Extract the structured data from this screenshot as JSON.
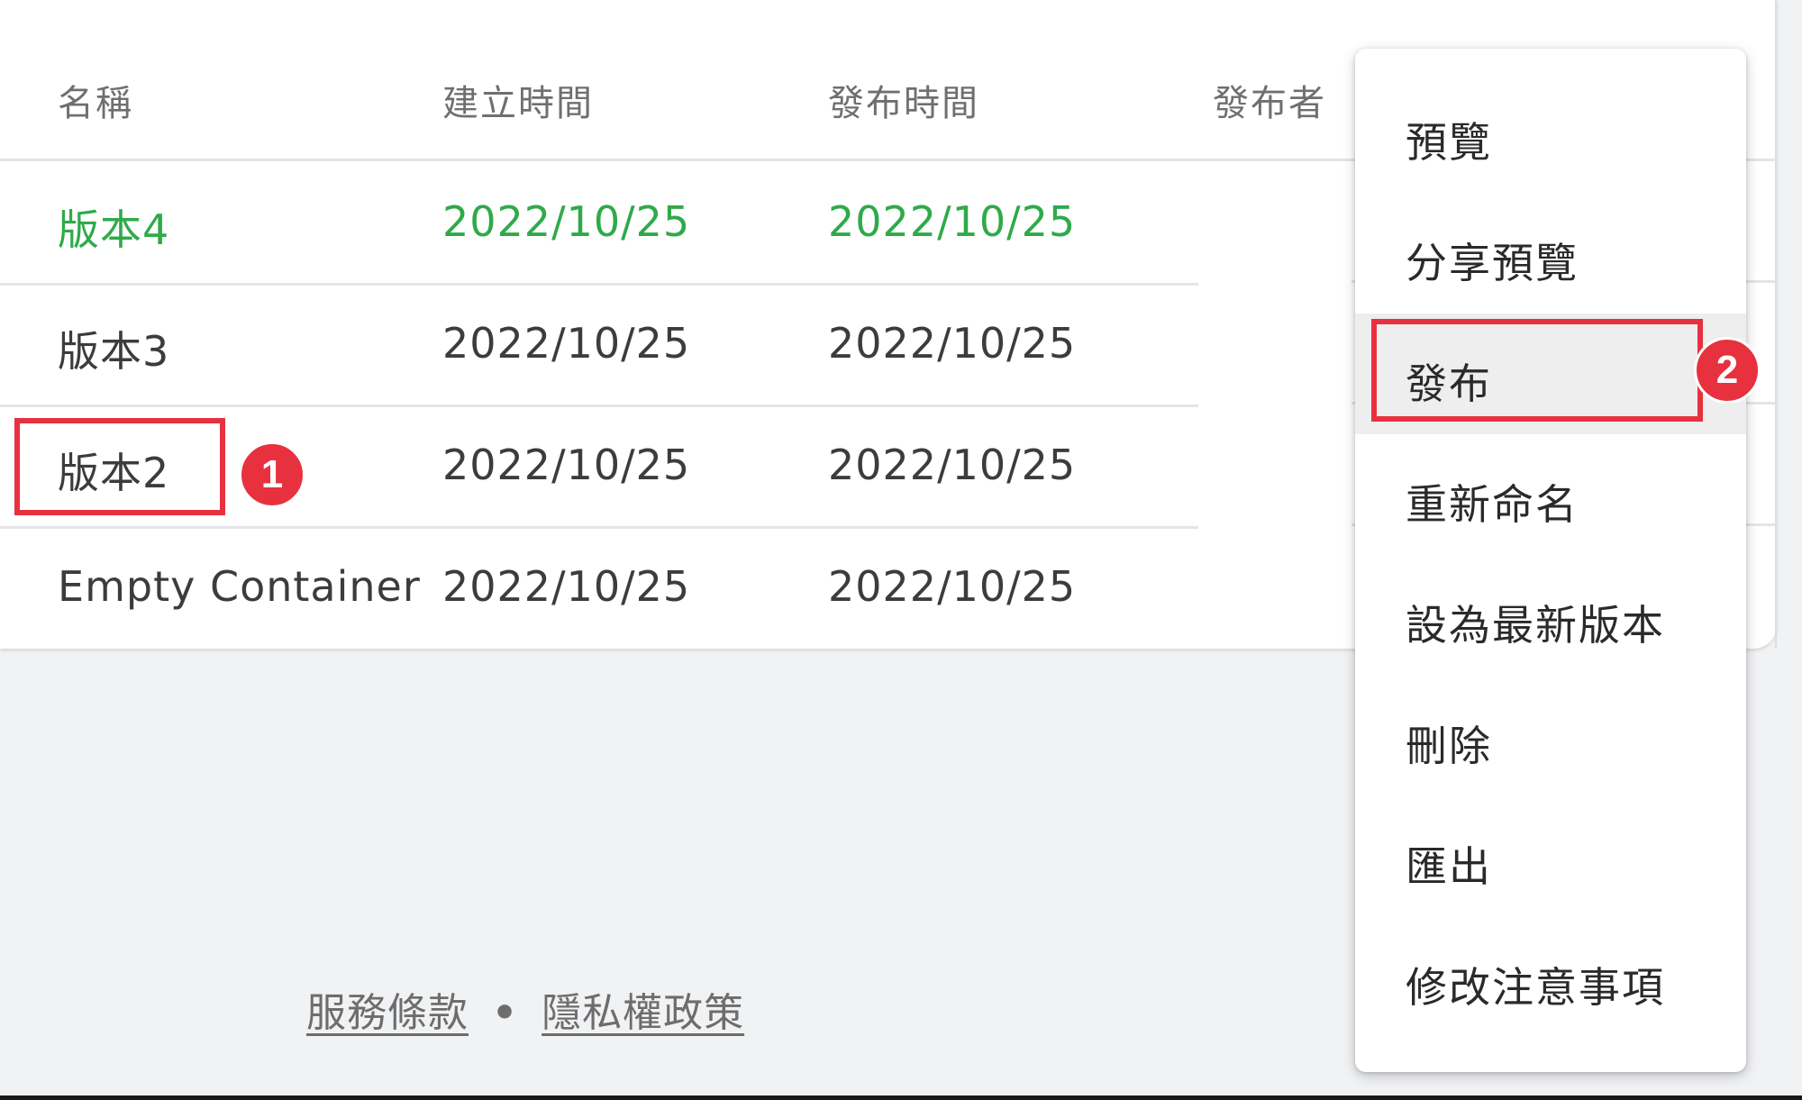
{
  "table": {
    "headers": [
      "名稱",
      "建立時間",
      "發布時間",
      "發布者"
    ],
    "rows": [
      {
        "name": "版本4",
        "created": "2022/10/25",
        "published": "2022/10/25",
        "active": true
      },
      {
        "name": "版本3",
        "created": "2022/10/25",
        "published": "2022/10/25",
        "active": false
      },
      {
        "name": "版本2",
        "created": "2022/10/25",
        "published": "2022/10/25",
        "active": false
      },
      {
        "name": "Empty Container",
        "created": "2022/10/25",
        "published": "2022/10/25",
        "active": false
      }
    ]
  },
  "menu": {
    "items": [
      "預覽",
      "分享預覽",
      "發布",
      "重新命名",
      "設為最新版本",
      "刪除",
      "匯出",
      "修改注意事項"
    ],
    "hovered_item": "發布"
  },
  "annotations": {
    "badge_1": "1",
    "badge_2": "2"
  },
  "footer": {
    "terms": "服務條款",
    "separator": "•",
    "privacy": "隱私權政策"
  },
  "colors": {
    "active_row": "#2faa4a",
    "annotation": "#e8313f",
    "page_background": "#f1f2f4"
  }
}
